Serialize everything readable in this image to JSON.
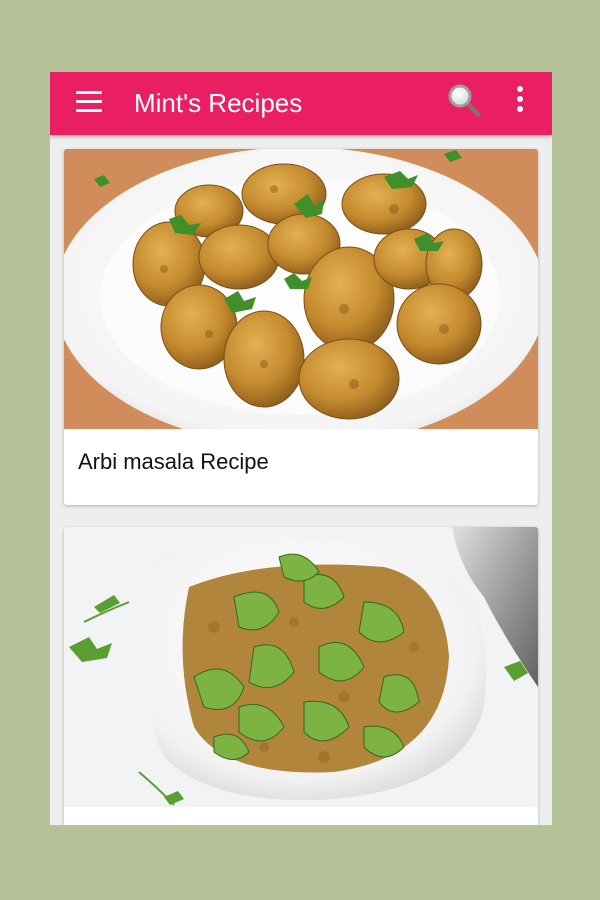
{
  "appbar": {
    "title": "Mint's Recipes",
    "menu_icon": "hamburger-menu-icon",
    "search_icon": "magnifier-search-icon",
    "overflow_icon": "more-vert-icon"
  },
  "recipes": [
    {
      "name": "Arbi masala Recipe",
      "image": "arbi-masala-photo"
    },
    {
      "name": "",
      "image": "capsicum-besan-sabzi-photo"
    }
  ],
  "colors": {
    "primary": "#e91e63",
    "page_background": "#b5c196",
    "list_background": "#eeeeee"
  }
}
